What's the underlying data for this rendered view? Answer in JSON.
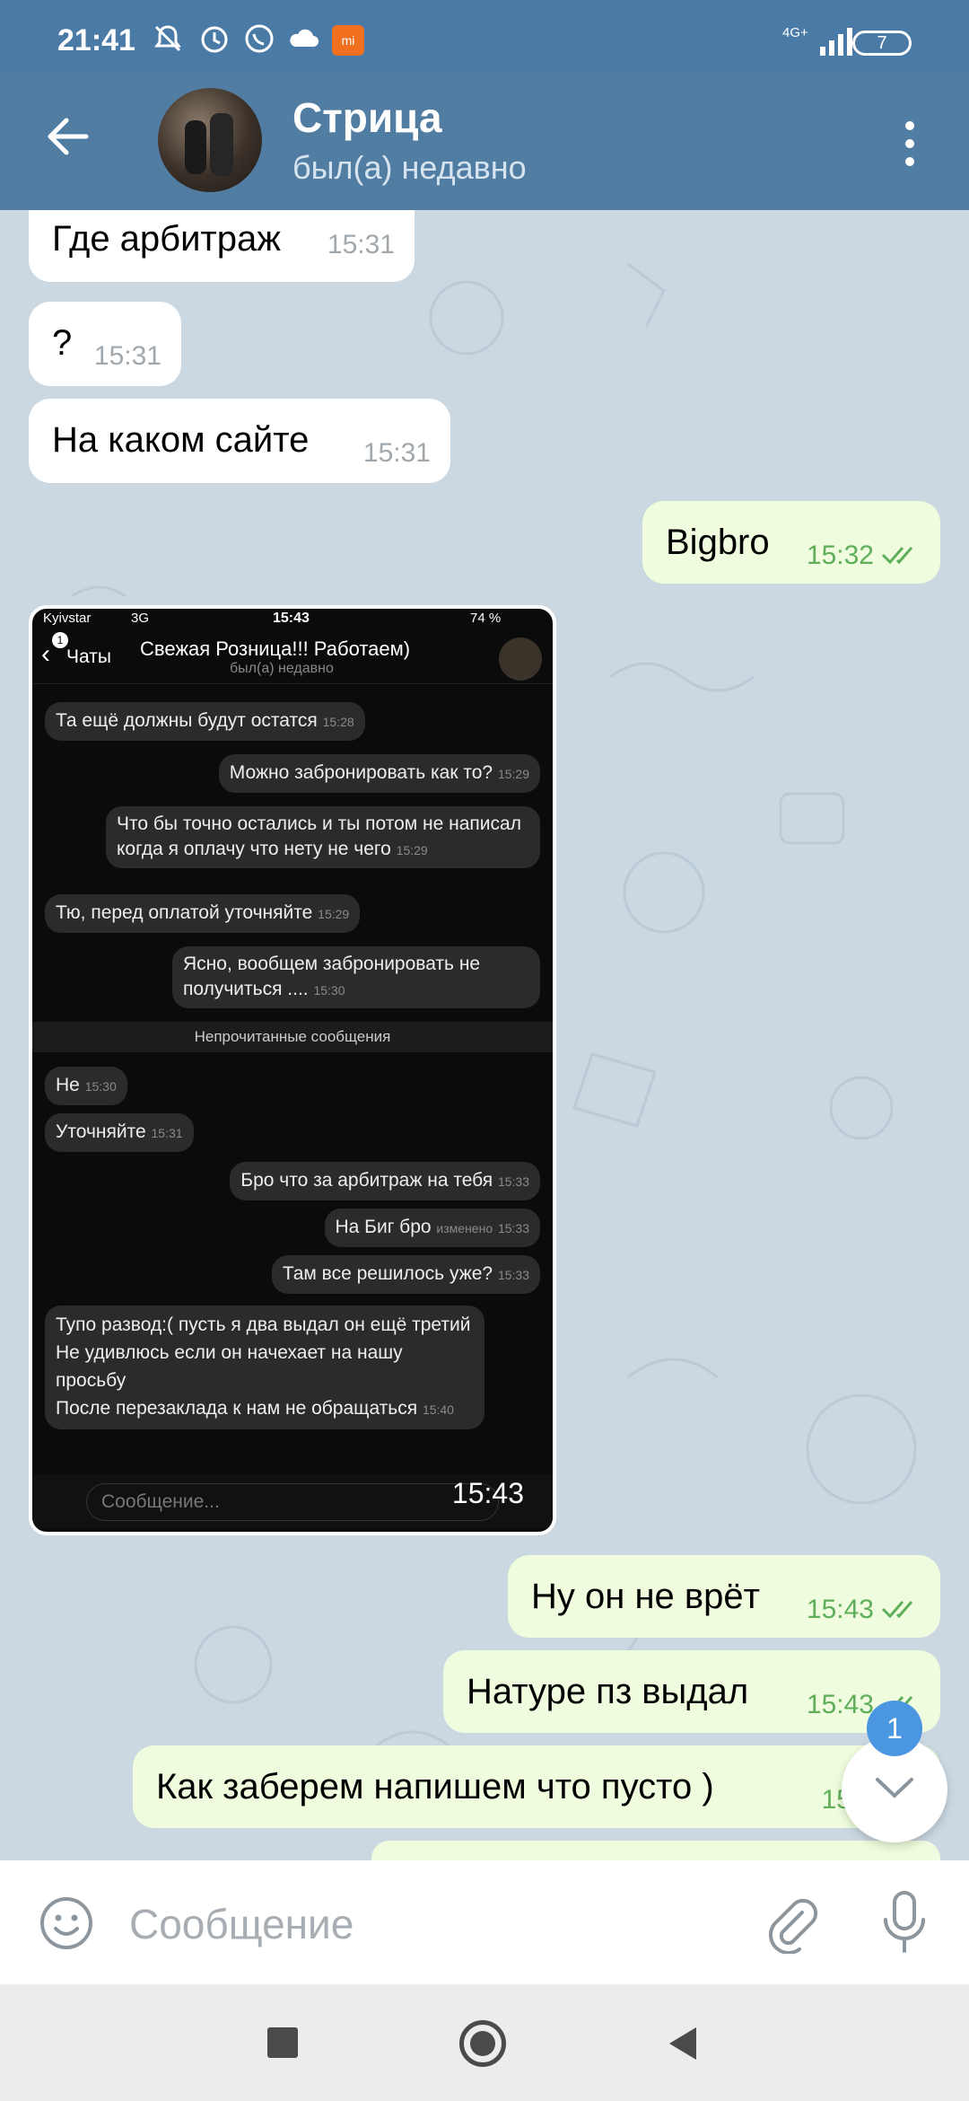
{
  "status_bar": {
    "time": "21:41",
    "network": "4G+",
    "battery": "7",
    "icons": [
      "mute-icon",
      "alarm-icon",
      "whatsapp-icon",
      "cloud-icon",
      "mi-app-icon",
      "signal-icon",
      "battery-icon"
    ]
  },
  "header": {
    "title": "Стрица",
    "status": "был(а) недавно"
  },
  "messages": [
    {
      "dir": "in",
      "text": "Где арбитраж",
      "time": "15:31"
    },
    {
      "dir": "in",
      "text": "?",
      "time": "15:31"
    },
    {
      "dir": "in",
      "text": "На каком сайте",
      "time": "15:31"
    },
    {
      "dir": "out",
      "text": "Bigbro",
      "time": "15:32"
    },
    {
      "dir": "in",
      "type": "image",
      "time": "15:43"
    },
    {
      "dir": "out",
      "text": "Ну он не врёт",
      "time": "15:43"
    },
    {
      "dir": "out",
      "text": "Натуре пз выдал",
      "time": "15:43"
    },
    {
      "dir": "out",
      "text": "Как заберем напишем что пусто )",
      "time": "15:4"
    }
  ],
  "screenshot": {
    "carrier": "Kyivstar",
    "net": "3G",
    "time": "15:43",
    "battery": "74 %",
    "back_label": "Чаты",
    "back_badge": "1",
    "title": "Свежая Розница!!! Работаем)",
    "status": "был(а) недавно",
    "msgs": [
      {
        "dir": "in",
        "text": "Та ещё должны будут остатся",
        "time": "15:28"
      },
      {
        "dir": "out",
        "text": "Можно забронировать как то?",
        "time": "15:29"
      },
      {
        "dir": "out",
        "text": "Что бы точно остались и ты потом не написал когда я оплачу что нету не чего",
        "time": "15:29"
      },
      {
        "dir": "in",
        "text": "Тю, перед оплатой уточняйте",
        "time": "15:29"
      },
      {
        "dir": "out",
        "text": "Ясно, вообщем забронировать не получиться ....",
        "time": "15:30"
      },
      {
        "dir": "in",
        "text": "Не",
        "time": "15:30"
      },
      {
        "dir": "in",
        "text": "Уточняйте",
        "time": "15:31"
      },
      {
        "dir": "out",
        "text": "Бро что за арбитраж на тебя",
        "time": "15:33"
      },
      {
        "dir": "out",
        "text": "На Биг бро",
        "time": "15:33",
        "edited": "изменено"
      },
      {
        "dir": "out",
        "text": "Там все решилось уже?",
        "time": "15:33"
      },
      {
        "dir": "in",
        "text": "Тупо развод:( пусть я два выдал он ещё третий\nНе удивлюсь если он начехает на нашу просьбу\nПосле перезаклада к нам не обращаться",
        "time": "15:40"
      }
    ],
    "unread_label": "Непрочитанные сообщения",
    "input_placeholder": "Сообщение..."
  },
  "fab": {
    "badge": "1"
  },
  "input": {
    "placeholder": "Сообщение"
  }
}
